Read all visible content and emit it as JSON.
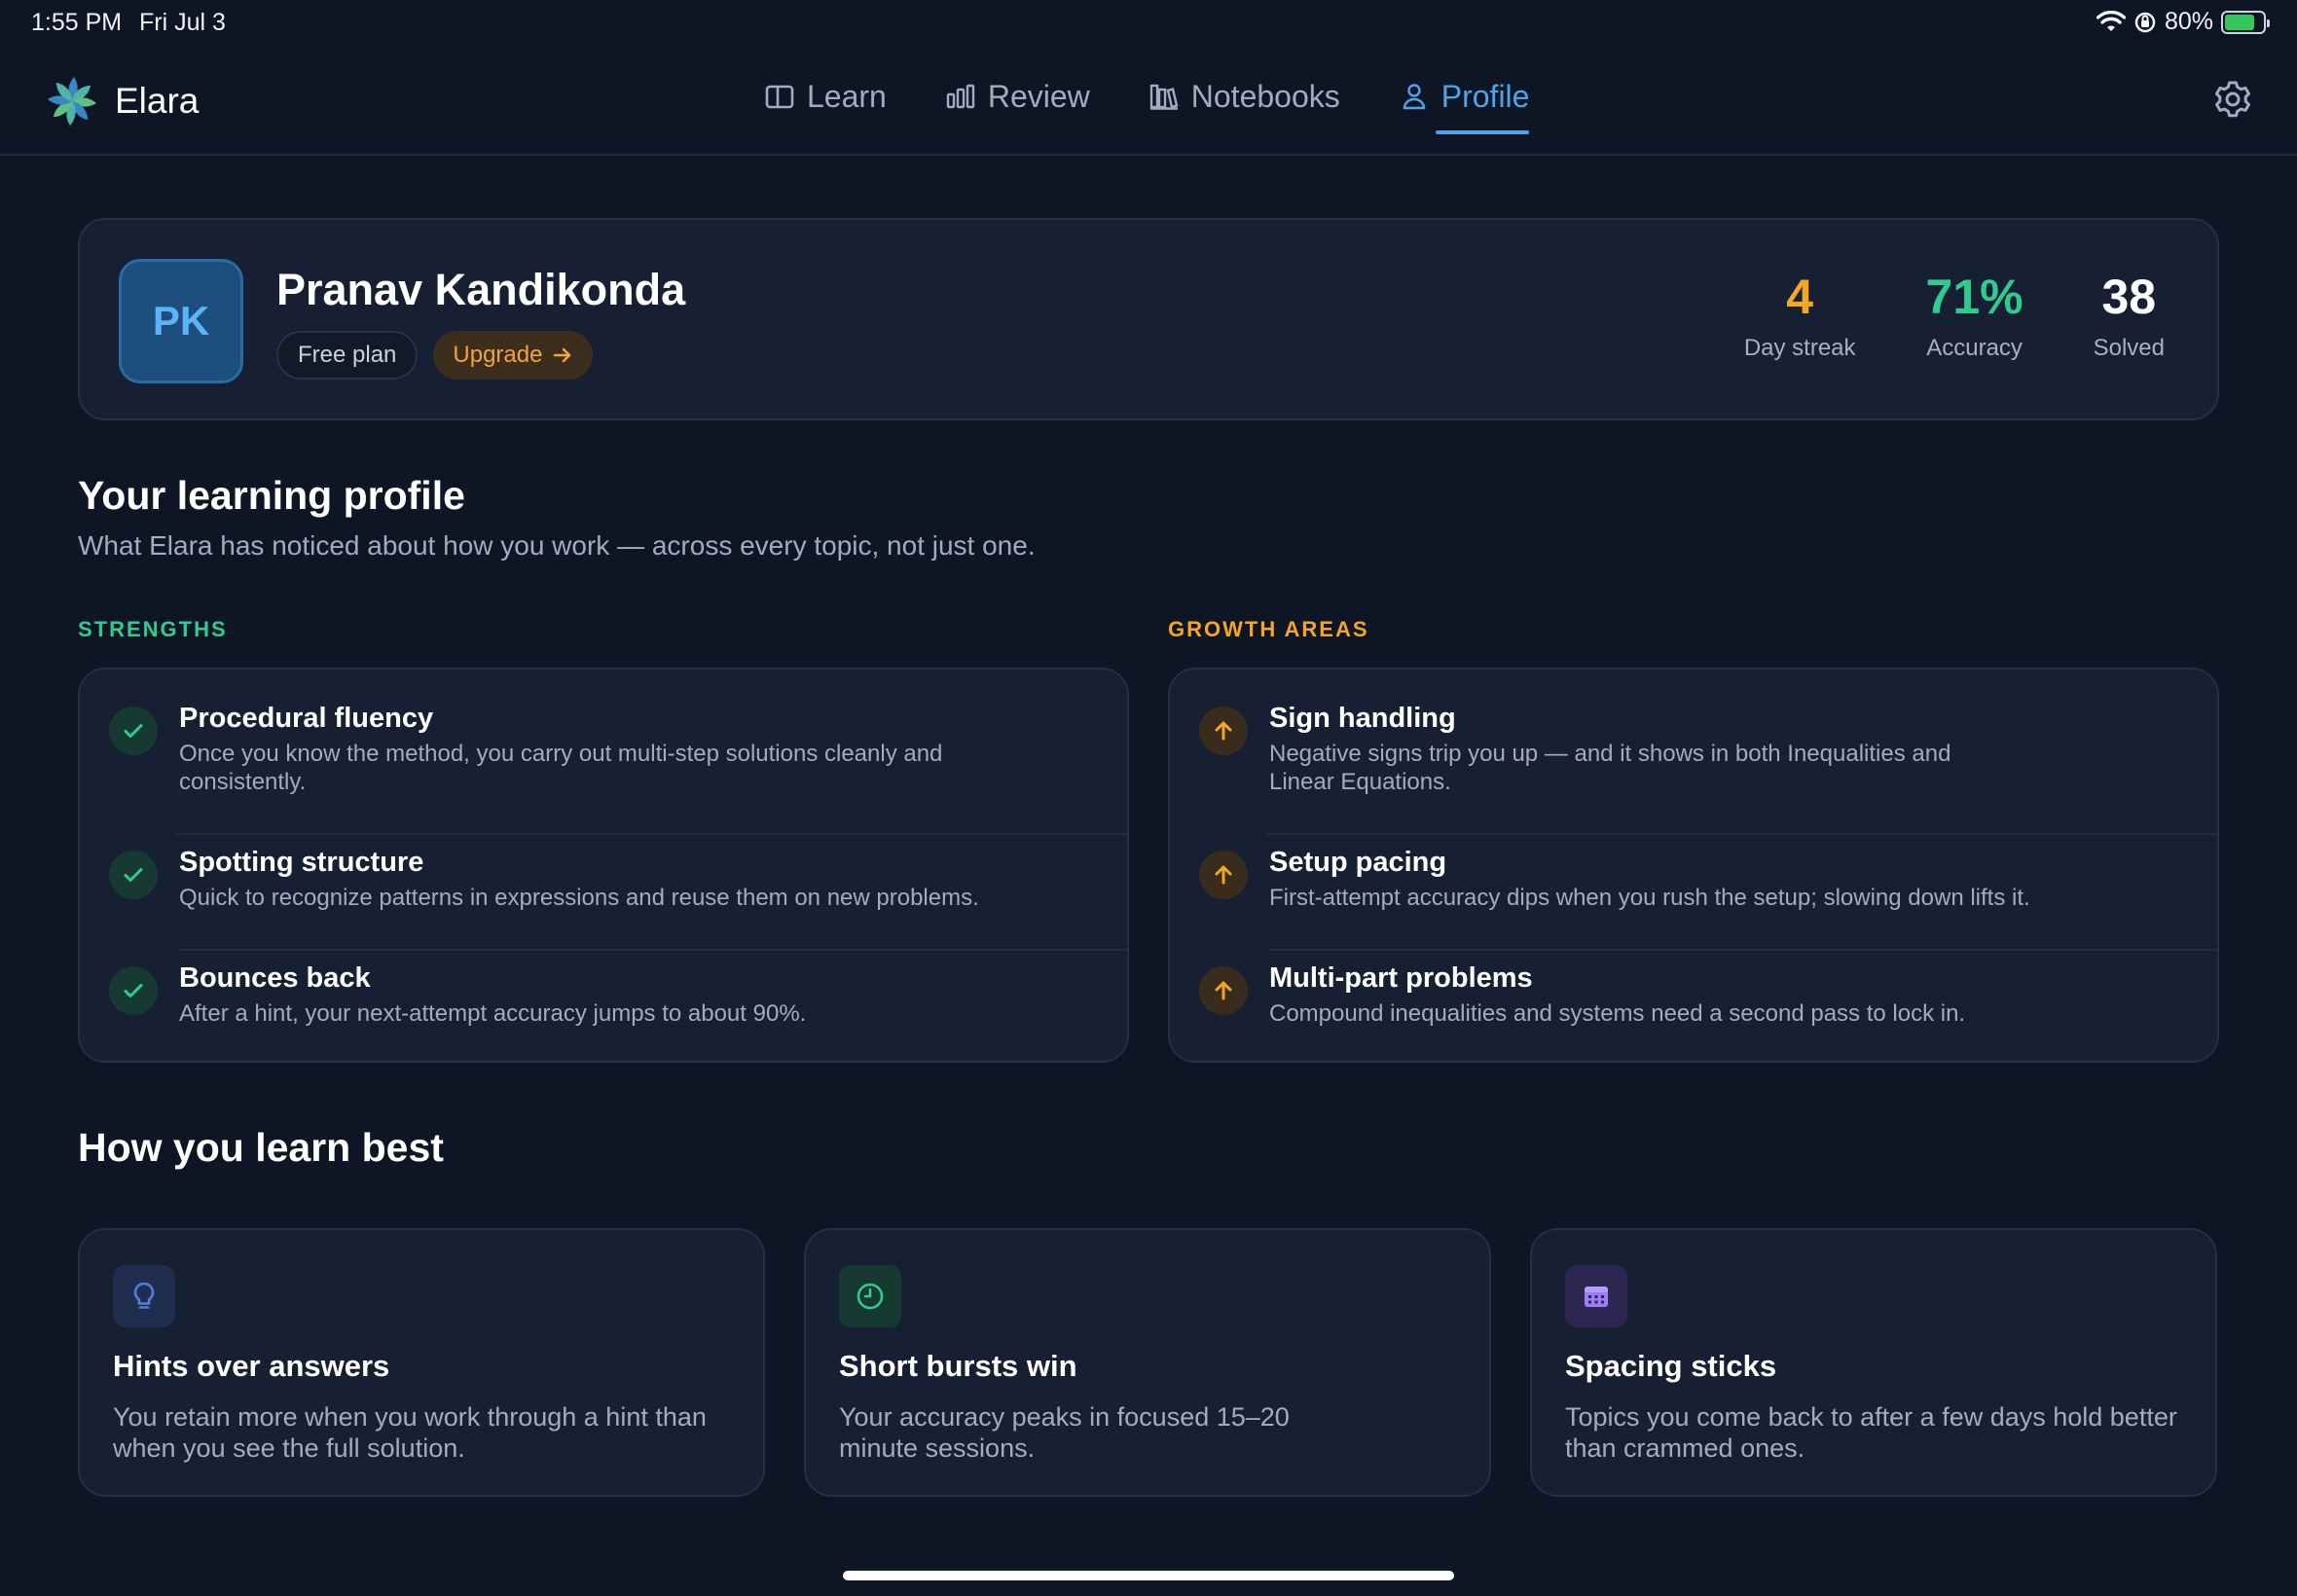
{
  "status_bar": {
    "time": "1:55 PM",
    "date": "Fri Jul 3",
    "battery": "80%",
    "battery_level": 0.8
  },
  "app": {
    "name": "Elara"
  },
  "nav": {
    "tabs": [
      {
        "label": "Learn",
        "icon": "book-open-icon",
        "active": false
      },
      {
        "label": "Review",
        "icon": "bar-chart-icon",
        "active": false
      },
      {
        "label": "Notebooks",
        "icon": "library-icon",
        "active": false
      },
      {
        "label": "Profile",
        "icon": "user-icon",
        "active": true
      }
    ],
    "settings_icon": "gear-icon"
  },
  "profile": {
    "initials": "PK",
    "name": "Pranav Kandikonda",
    "plan": "Free plan",
    "upgrade_label": "Upgrade",
    "stats": [
      {
        "value": "4",
        "label": "Day streak",
        "color": "#f5a623"
      },
      {
        "value": "71%",
        "label": "Accuracy",
        "color": "#2ecc8f"
      },
      {
        "value": "38",
        "label": "Solved",
        "color": "#ffffff"
      }
    ]
  },
  "learning_profile": {
    "title": "Your learning profile",
    "subtitle": "What Elara has noticed about how you work — across every topic, not just one.",
    "strengths": {
      "label": "STRENGTHS",
      "color": "#2ecc8f",
      "items": [
        {
          "title": "Procedural fluency",
          "desc": "Once you know the method, you carry out multi-step solutions cleanly and consistently."
        },
        {
          "title": "Spotting structure",
          "desc": "Quick to recognize patterns in expressions and reuse them on new problems."
        },
        {
          "title": "Bounces back",
          "desc": "After a hint, your next-attempt accuracy jumps to about 90%."
        }
      ]
    },
    "growth": {
      "label": "GROWTH AREAS",
      "color": "#f5a623",
      "items": [
        {
          "title": "Sign handling",
          "desc": "Negative signs trip you up — and it shows in both Inequalities and Linear Equations."
        },
        {
          "title": "Setup pacing",
          "desc": "First-attempt accuracy dips when you rush the setup; slowing down lifts it."
        },
        {
          "title": "Multi-part problems",
          "desc": "Compound inequalities and systems need a second pass to lock in."
        }
      ]
    }
  },
  "learn_best": {
    "title": "How you learn best",
    "tips": [
      {
        "icon": "lightbulb-icon",
        "title": "Hints over answers",
        "desc": "You retain more when you work through a hint than when you see the full solution."
      },
      {
        "icon": "clock-icon",
        "title": "Short bursts win",
        "desc": "Your accuracy peaks in focused 15–20 minute sessions."
      },
      {
        "icon": "calendar-icon",
        "title": "Spacing sticks",
        "desc": "Topics you come back to after a few days hold better than crammed ones."
      }
    ]
  }
}
